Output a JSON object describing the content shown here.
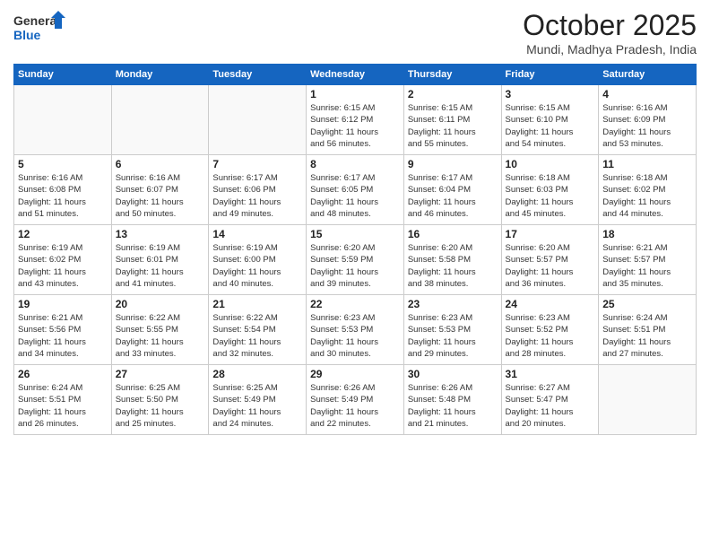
{
  "header": {
    "logo_line1": "General",
    "logo_line2": "Blue",
    "month_title": "October 2025",
    "location": "Mundi, Madhya Pradesh, India"
  },
  "days_of_week": [
    "Sunday",
    "Monday",
    "Tuesday",
    "Wednesday",
    "Thursday",
    "Friday",
    "Saturday"
  ],
  "weeks": [
    [
      {
        "day": "",
        "info": ""
      },
      {
        "day": "",
        "info": ""
      },
      {
        "day": "",
        "info": ""
      },
      {
        "day": "1",
        "info": "Sunrise: 6:15 AM\nSunset: 6:12 PM\nDaylight: 11 hours\nand 56 minutes."
      },
      {
        "day": "2",
        "info": "Sunrise: 6:15 AM\nSunset: 6:11 PM\nDaylight: 11 hours\nand 55 minutes."
      },
      {
        "day": "3",
        "info": "Sunrise: 6:15 AM\nSunset: 6:10 PM\nDaylight: 11 hours\nand 54 minutes."
      },
      {
        "day": "4",
        "info": "Sunrise: 6:16 AM\nSunset: 6:09 PM\nDaylight: 11 hours\nand 53 minutes."
      }
    ],
    [
      {
        "day": "5",
        "info": "Sunrise: 6:16 AM\nSunset: 6:08 PM\nDaylight: 11 hours\nand 51 minutes."
      },
      {
        "day": "6",
        "info": "Sunrise: 6:16 AM\nSunset: 6:07 PM\nDaylight: 11 hours\nand 50 minutes."
      },
      {
        "day": "7",
        "info": "Sunrise: 6:17 AM\nSunset: 6:06 PM\nDaylight: 11 hours\nand 49 minutes."
      },
      {
        "day": "8",
        "info": "Sunrise: 6:17 AM\nSunset: 6:05 PM\nDaylight: 11 hours\nand 48 minutes."
      },
      {
        "day": "9",
        "info": "Sunrise: 6:17 AM\nSunset: 6:04 PM\nDaylight: 11 hours\nand 46 minutes."
      },
      {
        "day": "10",
        "info": "Sunrise: 6:18 AM\nSunset: 6:03 PM\nDaylight: 11 hours\nand 45 minutes."
      },
      {
        "day": "11",
        "info": "Sunrise: 6:18 AM\nSunset: 6:02 PM\nDaylight: 11 hours\nand 44 minutes."
      }
    ],
    [
      {
        "day": "12",
        "info": "Sunrise: 6:19 AM\nSunset: 6:02 PM\nDaylight: 11 hours\nand 43 minutes."
      },
      {
        "day": "13",
        "info": "Sunrise: 6:19 AM\nSunset: 6:01 PM\nDaylight: 11 hours\nand 41 minutes."
      },
      {
        "day": "14",
        "info": "Sunrise: 6:19 AM\nSunset: 6:00 PM\nDaylight: 11 hours\nand 40 minutes."
      },
      {
        "day": "15",
        "info": "Sunrise: 6:20 AM\nSunset: 5:59 PM\nDaylight: 11 hours\nand 39 minutes."
      },
      {
        "day": "16",
        "info": "Sunrise: 6:20 AM\nSunset: 5:58 PM\nDaylight: 11 hours\nand 38 minutes."
      },
      {
        "day": "17",
        "info": "Sunrise: 6:20 AM\nSunset: 5:57 PM\nDaylight: 11 hours\nand 36 minutes."
      },
      {
        "day": "18",
        "info": "Sunrise: 6:21 AM\nSunset: 5:57 PM\nDaylight: 11 hours\nand 35 minutes."
      }
    ],
    [
      {
        "day": "19",
        "info": "Sunrise: 6:21 AM\nSunset: 5:56 PM\nDaylight: 11 hours\nand 34 minutes."
      },
      {
        "day": "20",
        "info": "Sunrise: 6:22 AM\nSunset: 5:55 PM\nDaylight: 11 hours\nand 33 minutes."
      },
      {
        "day": "21",
        "info": "Sunrise: 6:22 AM\nSunset: 5:54 PM\nDaylight: 11 hours\nand 32 minutes."
      },
      {
        "day": "22",
        "info": "Sunrise: 6:23 AM\nSunset: 5:53 PM\nDaylight: 11 hours\nand 30 minutes."
      },
      {
        "day": "23",
        "info": "Sunrise: 6:23 AM\nSunset: 5:53 PM\nDaylight: 11 hours\nand 29 minutes."
      },
      {
        "day": "24",
        "info": "Sunrise: 6:23 AM\nSunset: 5:52 PM\nDaylight: 11 hours\nand 28 minutes."
      },
      {
        "day": "25",
        "info": "Sunrise: 6:24 AM\nSunset: 5:51 PM\nDaylight: 11 hours\nand 27 minutes."
      }
    ],
    [
      {
        "day": "26",
        "info": "Sunrise: 6:24 AM\nSunset: 5:51 PM\nDaylight: 11 hours\nand 26 minutes."
      },
      {
        "day": "27",
        "info": "Sunrise: 6:25 AM\nSunset: 5:50 PM\nDaylight: 11 hours\nand 25 minutes."
      },
      {
        "day": "28",
        "info": "Sunrise: 6:25 AM\nSunset: 5:49 PM\nDaylight: 11 hours\nand 24 minutes."
      },
      {
        "day": "29",
        "info": "Sunrise: 6:26 AM\nSunset: 5:49 PM\nDaylight: 11 hours\nand 22 minutes."
      },
      {
        "day": "30",
        "info": "Sunrise: 6:26 AM\nSunset: 5:48 PM\nDaylight: 11 hours\nand 21 minutes."
      },
      {
        "day": "31",
        "info": "Sunrise: 6:27 AM\nSunset: 5:47 PM\nDaylight: 11 hours\nand 20 minutes."
      },
      {
        "day": "",
        "info": ""
      }
    ]
  ]
}
